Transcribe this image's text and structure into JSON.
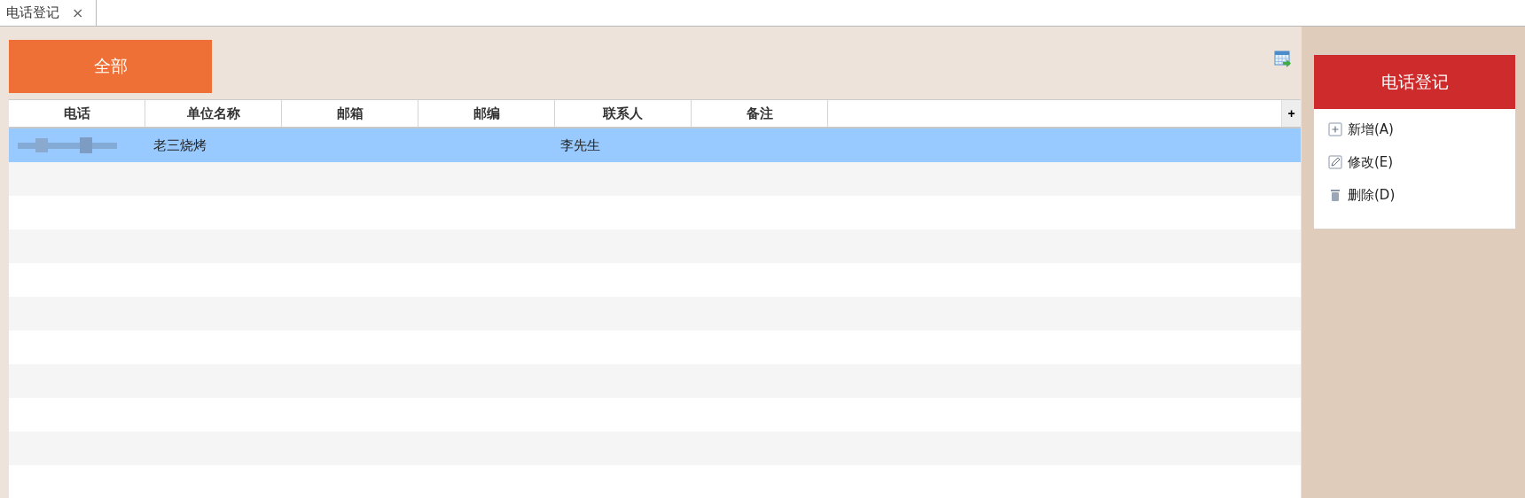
{
  "tabs": [
    {
      "label": "电话登记",
      "close": "×",
      "selected": true
    }
  ],
  "filter_button": "全部",
  "table": {
    "columns": [
      "电话",
      "单位名称",
      "邮箱",
      "邮编",
      "联系人",
      "备注"
    ],
    "add_column": "+",
    "rows": [
      {
        "phone_redacted": true,
        "cells": [
          "",
          "老三烧烤",
          "",
          "",
          "李先生",
          ""
        ],
        "selected": true
      }
    ]
  },
  "panel": {
    "title": "电话登记",
    "actions": [
      {
        "kind": "add",
        "label": "新增(A)"
      },
      {
        "kind": "edit",
        "label": "修改(E)"
      },
      {
        "kind": "delete",
        "label": "删除(D)"
      }
    ]
  }
}
